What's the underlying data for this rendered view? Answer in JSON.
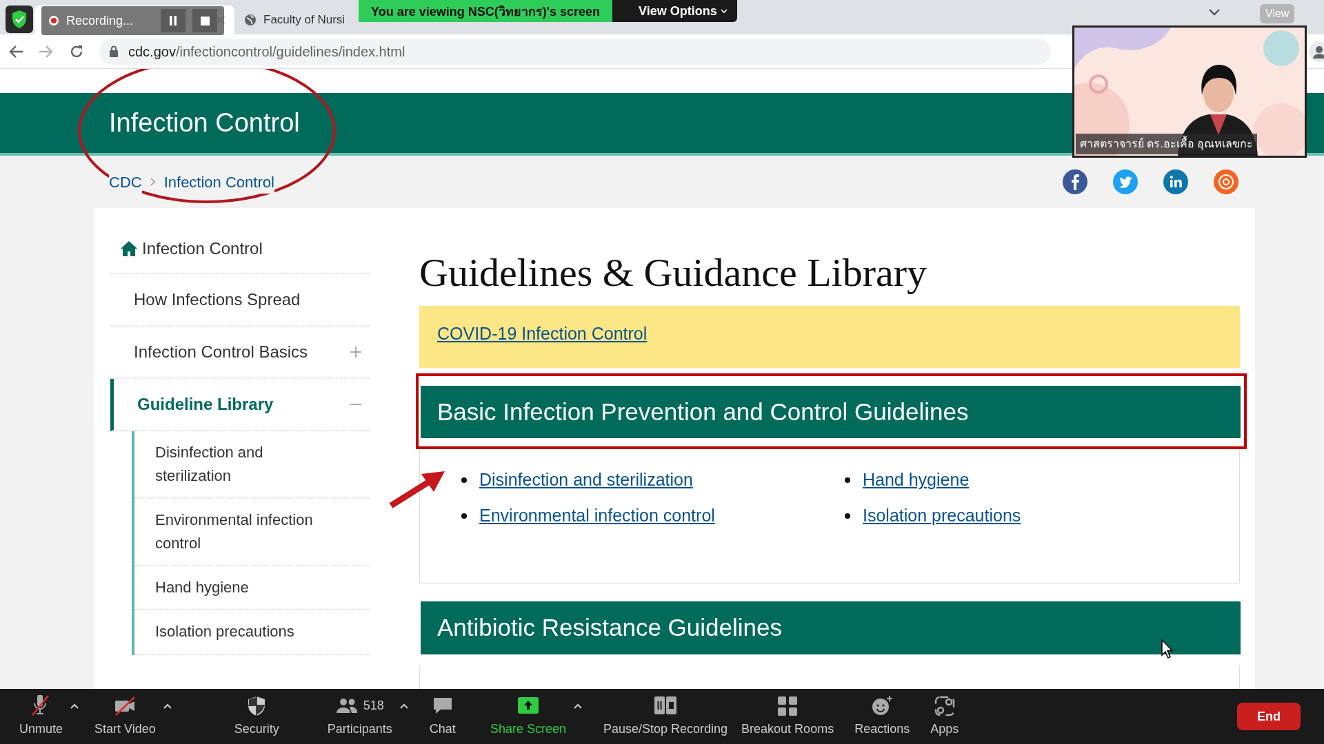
{
  "zoom_banner": {
    "text": "You are viewing NSC(วิทยากร)'s screen",
    "view_options": "View Options"
  },
  "recording": {
    "label": "Recording..."
  },
  "browser": {
    "tabs": [
      {
        "selected": true
      },
      {
        "title": "Faculty of Nursi",
        "selected": false
      }
    ],
    "url_host": "cdc.gov",
    "url_path": "/infectioncontrol/guidelines/index.html"
  },
  "view_button": {
    "label": "View"
  },
  "site": {
    "banner_title": "Infection Control",
    "breadcrumb": [
      "CDC",
      "Infection Control"
    ],
    "sidebar": [
      {
        "label": "Infection Control",
        "kind": "home",
        "selected": false
      },
      {
        "label": "How Infections Spread",
        "kind": "link",
        "selected": false
      },
      {
        "label": "Infection Control Basics",
        "kind": "expandable",
        "expanded": false,
        "selected": false
      },
      {
        "label": "Guideline Library",
        "kind": "expandable",
        "expanded": true,
        "selected": true,
        "children": [
          {
            "label": "Disinfection and sterilization",
            "selected": false
          },
          {
            "label": "Environmental infection control",
            "selected": false
          },
          {
            "label": "Hand hygiene",
            "selected": false
          },
          {
            "label": "Isolation precautions",
            "selected": false
          }
        ]
      }
    ],
    "title": "Guidelines & Guidance Library",
    "covid_link": "COVID-19 Infection Control",
    "sections": [
      {
        "heading": "Basic Infection Prevention and Control Guidelines",
        "highlighted": true,
        "links": [
          "Disinfection and sterilization",
          "Hand hygiene",
          "Environmental infection control",
          "Isolation precautions"
        ]
      },
      {
        "heading": "Antibiotic Resistance Guidelines",
        "highlighted": false
      }
    ]
  },
  "video": {
    "name": "ศาสตราจารย์ ดร.อะเคื้อ อุณหเลขกะ"
  },
  "toolbar": [
    {
      "label": "Unmute",
      "kind": "mic",
      "has_menu": true
    },
    {
      "label": "Start Video",
      "kind": "video",
      "has_menu": true
    },
    {
      "label": "Security",
      "kind": "security",
      "has_menu": false
    },
    {
      "label": "Participants",
      "kind": "participants",
      "count": "518",
      "has_menu": true
    },
    {
      "label": "Chat",
      "kind": "chat",
      "has_menu": false
    },
    {
      "label": "Share Screen",
      "kind": "share",
      "has_menu": true
    },
    {
      "label": "Pause/Stop Recording",
      "kind": "recording",
      "has_menu": false
    },
    {
      "label": "Breakout Rooms",
      "kind": "rooms",
      "has_menu": false
    },
    {
      "label": "Reactions",
      "kind": "reactions",
      "has_menu": false
    },
    {
      "label": "Apps",
      "kind": "apps",
      "has_menu": false
    }
  ],
  "end_button": "End"
}
